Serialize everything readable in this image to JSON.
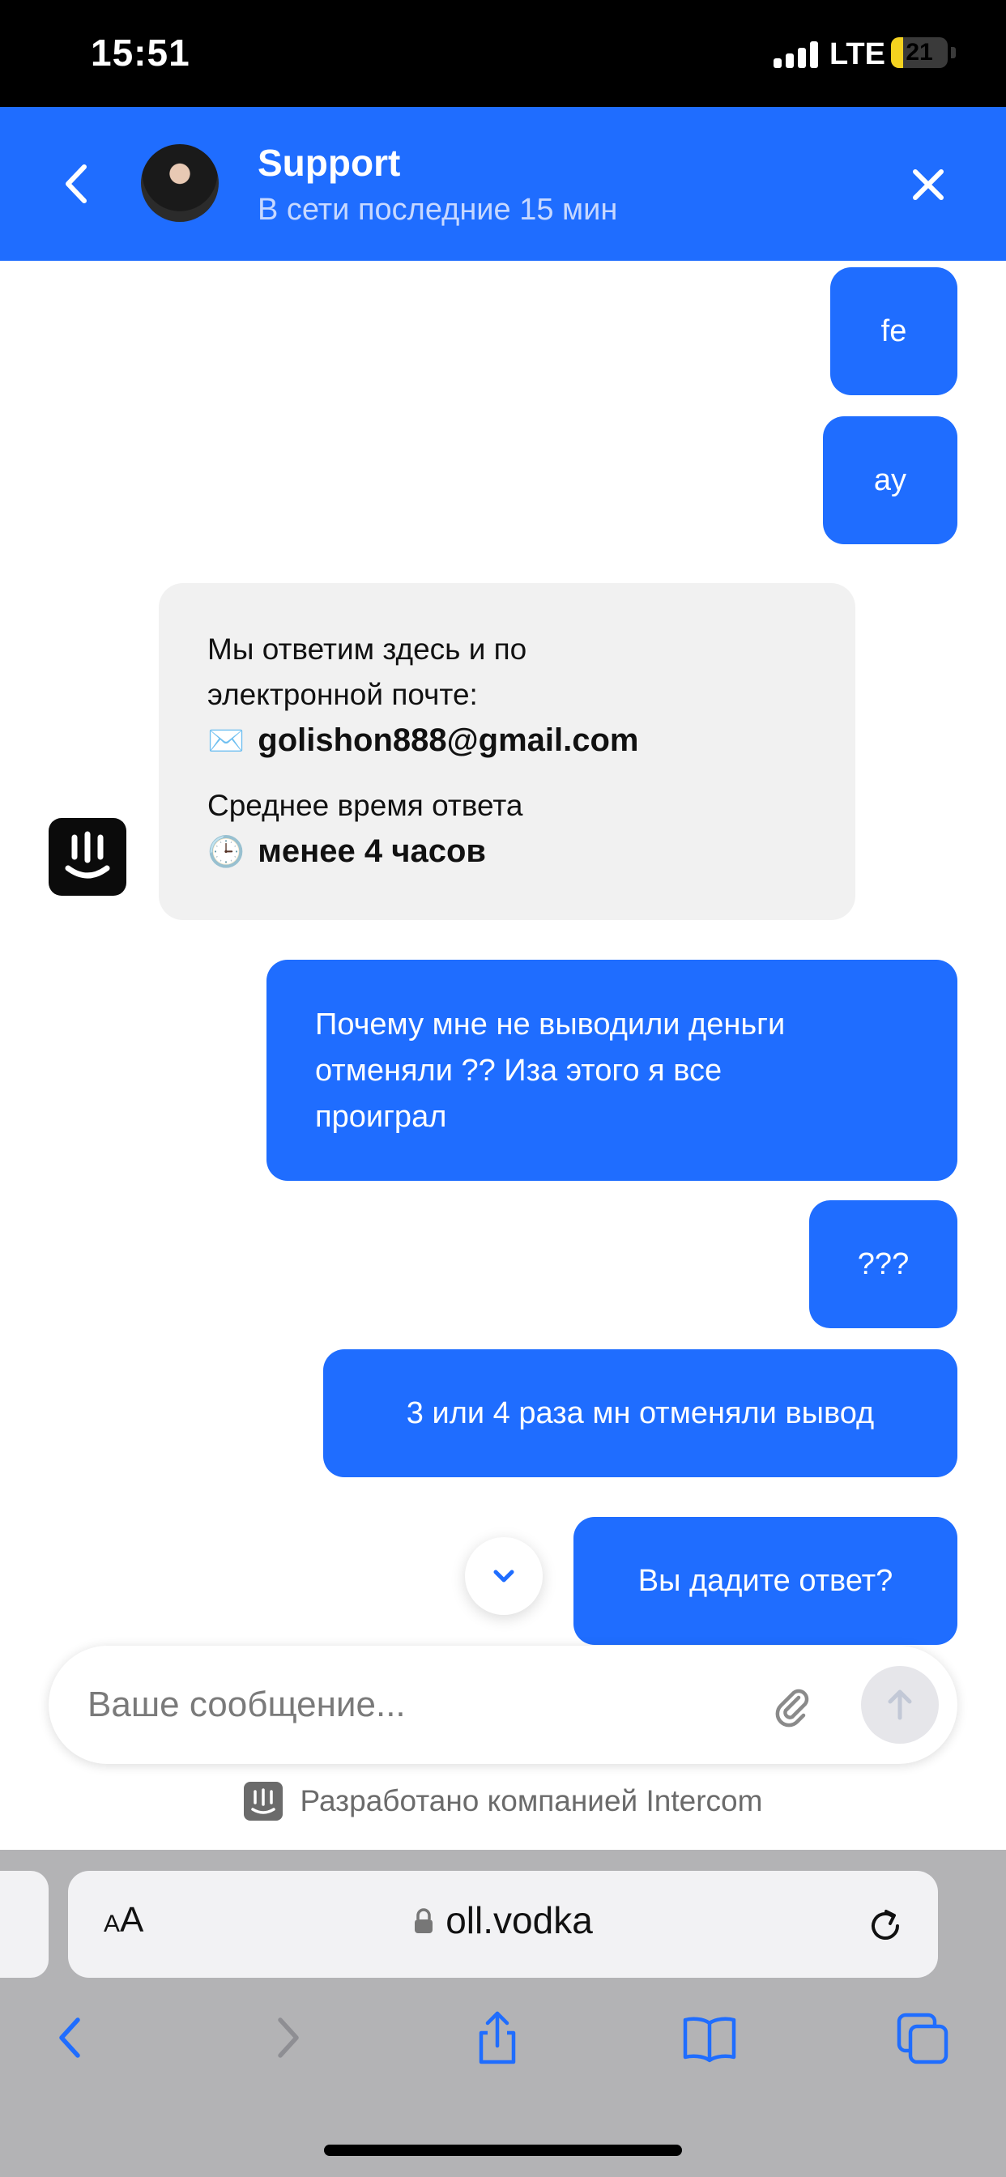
{
  "status_bar": {
    "time": "15:51",
    "network": "LTE",
    "battery_level": "21",
    "battery_fraction": 0.21
  },
  "header": {
    "title": "Support",
    "subtitle": "В сети последние 15 мин"
  },
  "messages": {
    "m1": "fe",
    "m2": "ay",
    "m3_line1": "Почему мне не выводили деньги",
    "m3_line2": "отменяли ?? Иза этого я все",
    "m3_line3": "проиграл",
    "m4": "???",
    "m5": "3 или 4 раза мн отменяли вывод",
    "m6": "Вы дадите ответ?"
  },
  "bot_card": {
    "line1": "Мы ответим здесь и по",
    "line2": "электронной почте:",
    "email_emoji": "✉️",
    "email": "golishon888@gmail.com",
    "response_label": "Среднее время ответа",
    "clock_emoji": "🕒",
    "response_time": "менее 4 часов"
  },
  "composer": {
    "placeholder": "Ваше сообщение..."
  },
  "powered_by": "Разработано компанией Intercom",
  "browser": {
    "aa_small": "A",
    "aa_large": "A",
    "url": "oll.vodka"
  },
  "colors": {
    "accent": "#1f6dff",
    "bot_bubble": "#f1f1f1",
    "browser_chrome": "#b3b3b5",
    "battery": "#f4d21f"
  }
}
